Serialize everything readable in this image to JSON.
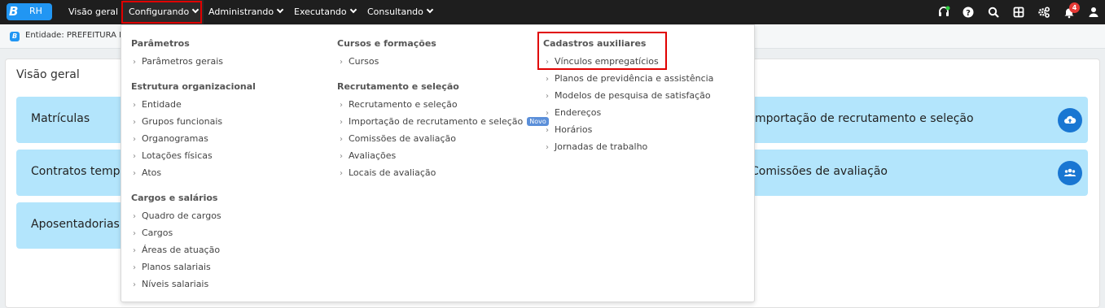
{
  "app": {
    "logo_letter": "B",
    "logo_label": "RH"
  },
  "nav": {
    "items": [
      {
        "label": "Visão geral",
        "has_dropdown": false
      },
      {
        "label": "Configurando",
        "has_dropdown": true,
        "active": true
      },
      {
        "label": "Administrando",
        "has_dropdown": true
      },
      {
        "label": "Executando",
        "has_dropdown": true
      },
      {
        "label": "Consultando",
        "has_dropdown": true
      }
    ],
    "notification_count": "4",
    "icons": [
      "headset-icon",
      "help-icon",
      "search-icon",
      "apps-grid-icon",
      "settings-gears-icon",
      "bell-icon",
      "user-icon"
    ]
  },
  "entity": {
    "icon_letter": "B",
    "text": "Entidade: PREFEITURA D"
  },
  "main": {
    "title": "Visão geral",
    "cards_left": [
      "Matrículas",
      "Contratos temp",
      "Aposentadorias"
    ],
    "cards_right": [
      {
        "label": "mportação de recrutamento e seleção",
        "icon": "cloud-upload-icon"
      },
      {
        "label": "Comissões de avaliação",
        "icon": "group-icon"
      }
    ]
  },
  "dropdown": {
    "col1": {
      "groups": [
        {
          "title": "Parâmetros",
          "items": [
            "Parâmetros gerais"
          ]
        },
        {
          "title": "Estrutura organizacional",
          "items": [
            "Entidade",
            "Grupos funcionais",
            "Organogramas",
            "Lotações físicas",
            "Atos"
          ]
        },
        {
          "title": "Cargos e salários",
          "items": [
            "Quadro de cargos",
            "Cargos",
            "Áreas de atuação",
            "Planos salariais",
            "Níveis salariais"
          ]
        }
      ]
    },
    "col2": {
      "groups": [
        {
          "title": "Cursos e formações",
          "items": [
            "Cursos"
          ]
        },
        {
          "title": "Recrutamento e seleção",
          "items": [
            "Recrutamento e seleção",
            "Importação de recrutamento e seleção",
            "Comissões de avaliação",
            "Avaliações",
            "Locais de avaliação"
          ]
        }
      ],
      "new_badge": "Novo"
    },
    "col3": {
      "groups": [
        {
          "title": "Cadastros auxiliares",
          "items": [
            "Vínculos empregatícios",
            "Planos de previdência e assistência",
            "Modelos de pesquisa de satisfação",
            "Endereços",
            "Horários",
            "Jornadas de trabalho"
          ]
        }
      ]
    }
  },
  "colors": {
    "navbar": "#1e1e1e",
    "brand": "#2196f3",
    "card": "#b3e5fc",
    "card_icon": "#1976d2",
    "highlight": "#e00000",
    "badge": "#5b8fd9"
  }
}
